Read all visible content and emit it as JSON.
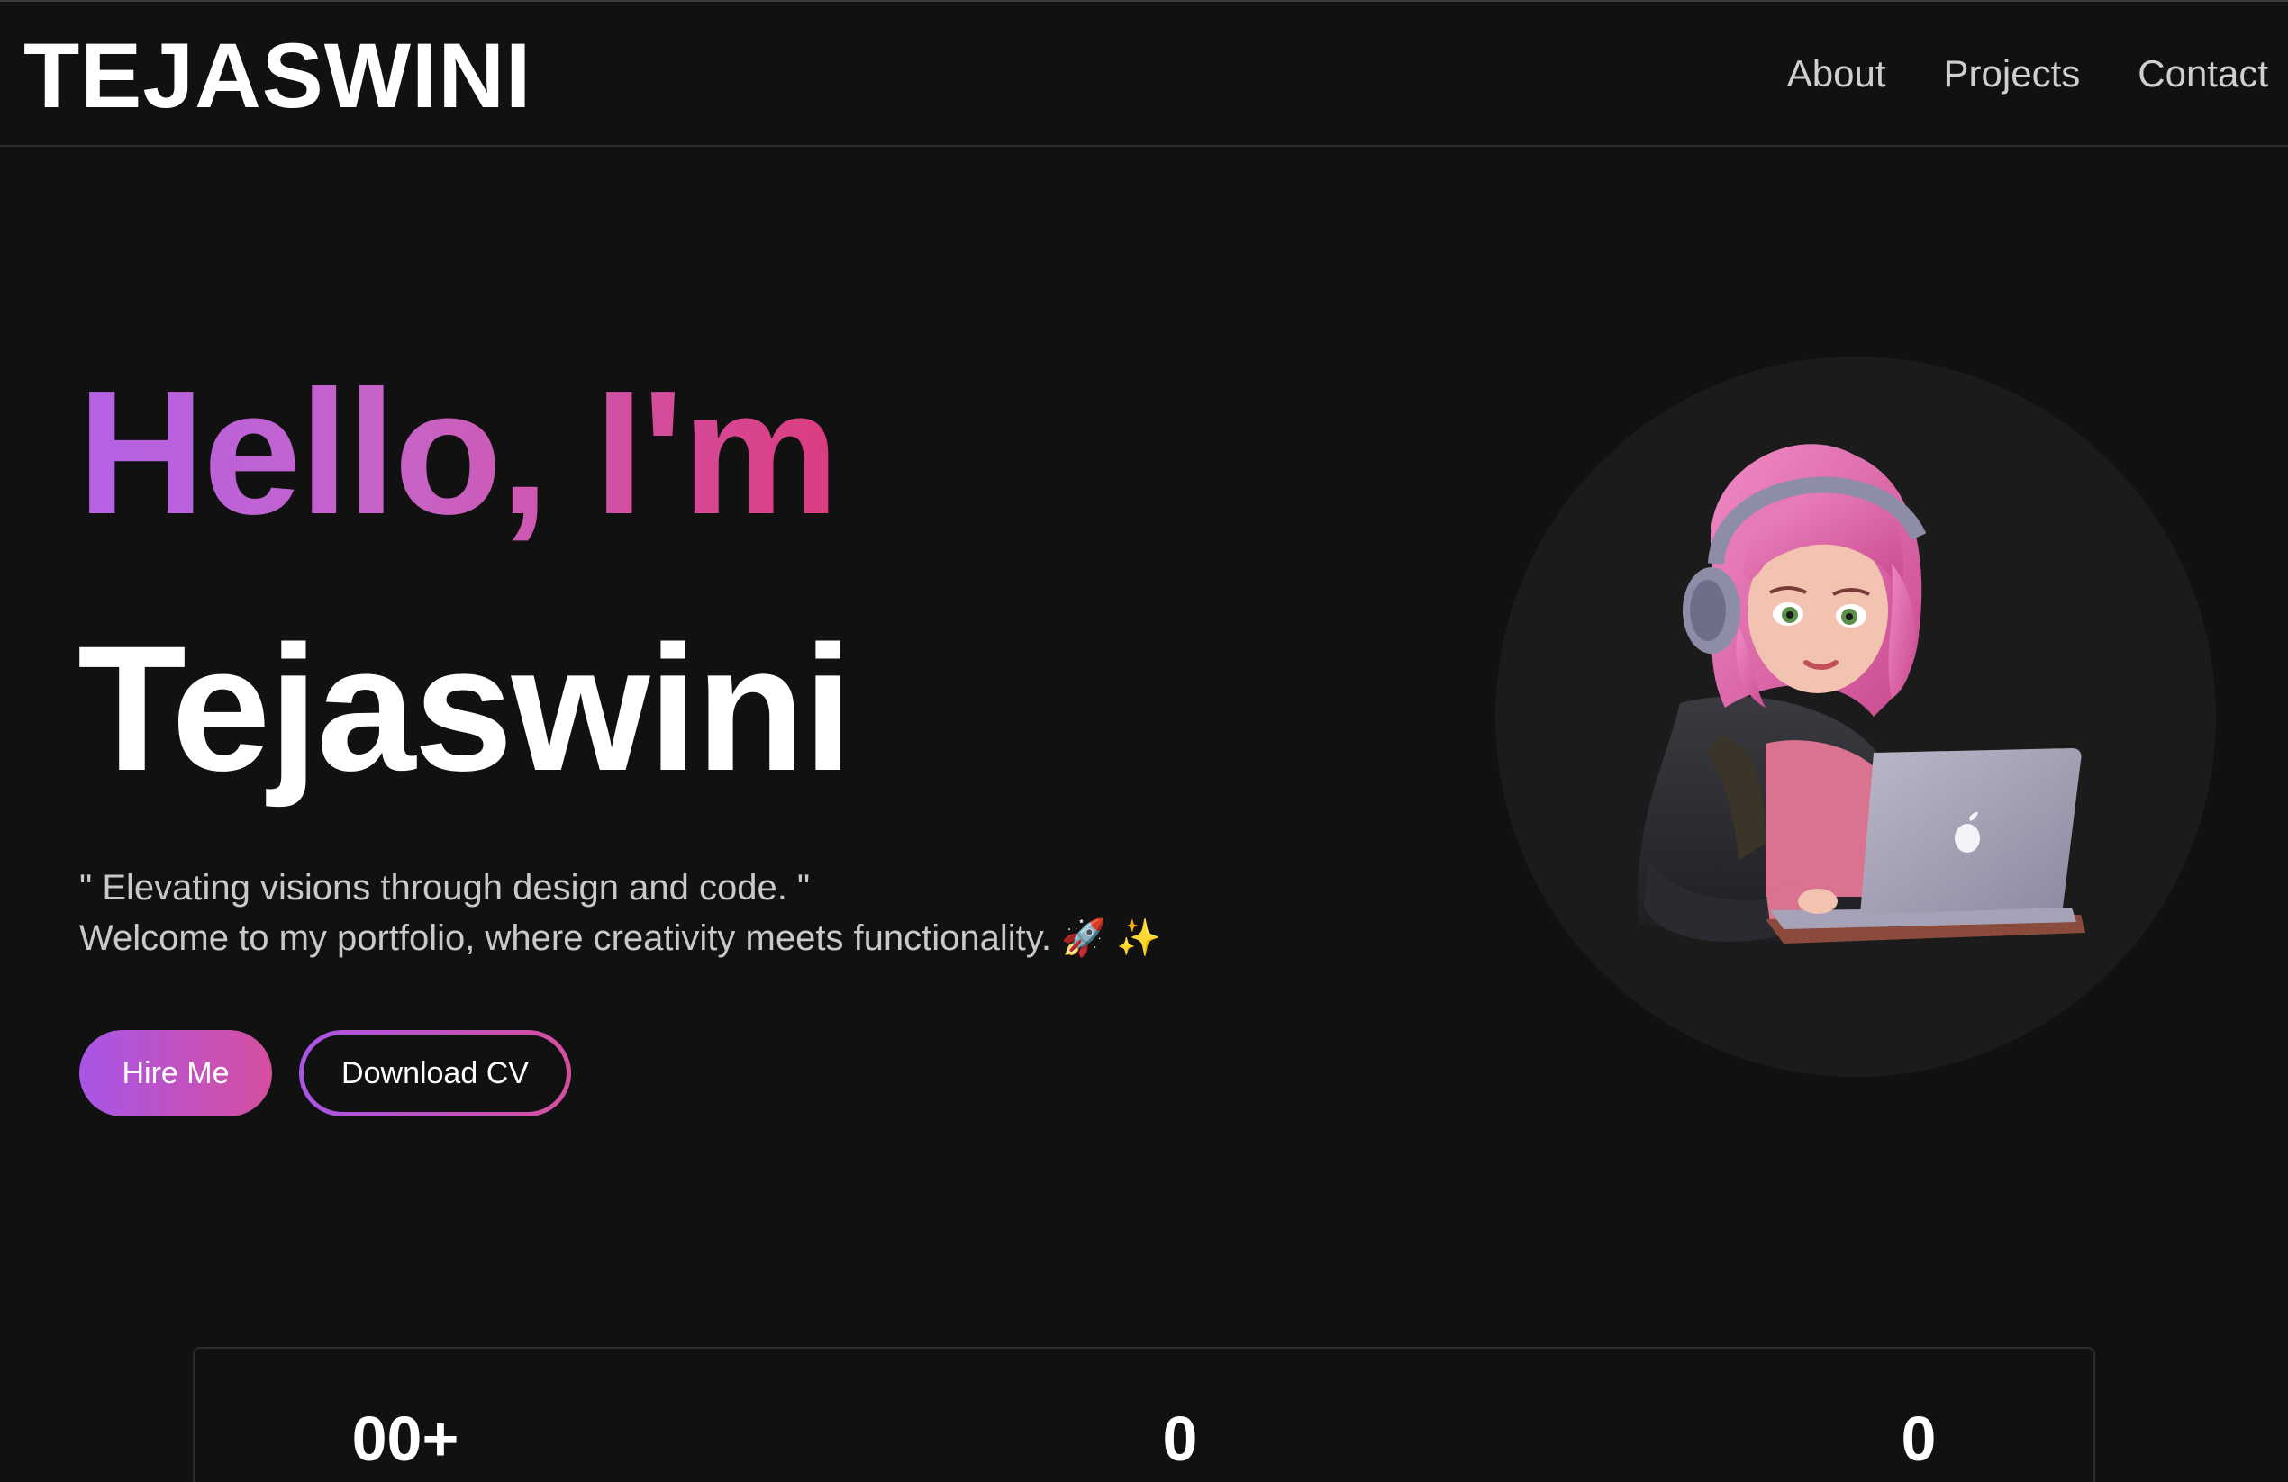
{
  "nav": {
    "brand": "TEJASWINI",
    "links": [
      "About",
      "Projects",
      "Contact"
    ]
  },
  "hero": {
    "greeting": "Hello, I'm",
    "name": "Tejaswini",
    "tagline_line1": "\" Elevating visions through design and code. \"",
    "tagline_line2": "Welcome to my portfolio, where creativity meets functionality. 🚀 ✨",
    "hire_label": "Hire Me",
    "cv_label": "Download CV"
  },
  "stats": {
    "values": [
      "00+",
      "0",
      "0"
    ]
  },
  "colors": {
    "background": "#111111",
    "gradient_start": "#a855e8",
    "gradient_end": "#dc3c7e",
    "avatar_circle": "#1b1b1b"
  },
  "icons": {
    "avatar": "girl-with-headphones-laptop-illustration"
  }
}
